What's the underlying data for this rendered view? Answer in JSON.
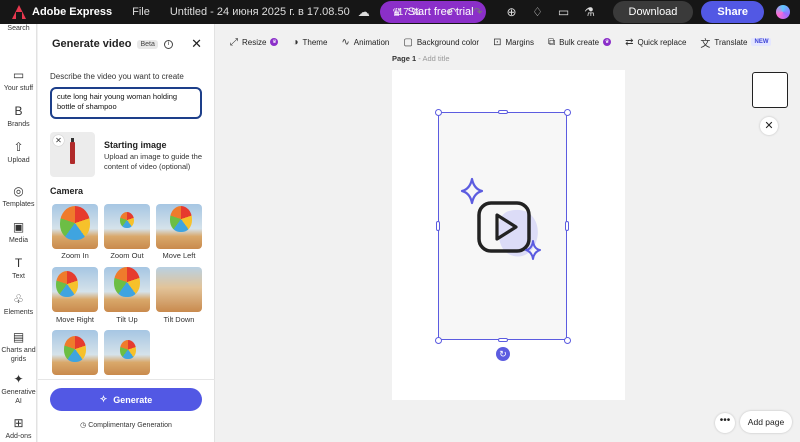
{
  "topbar": {
    "app_name": "Adobe Express",
    "file_menu": "File",
    "doc_title": "Untitled - 24 июня 2025 г. в 17.08.50",
    "trial_label": "Start free trial",
    "zoom": "17 %",
    "download_label": "Download",
    "share_label": "Share"
  },
  "rail": {
    "items": [
      {
        "label": "Search",
        "icon": "search-icon"
      },
      {
        "label": "Your stuff",
        "icon": "folder-icon"
      },
      {
        "label": "Brands",
        "icon": "brand-icon"
      },
      {
        "label": "Upload",
        "icon": "upload-icon"
      },
      {
        "label": "Templates",
        "icon": "templates-icon"
      },
      {
        "label": "Media",
        "icon": "media-icon"
      },
      {
        "label": "Text",
        "icon": "text-icon"
      },
      {
        "label": "Elements",
        "icon": "elements-icon"
      },
      {
        "label": "Charts and grids",
        "icon": "charts-icon"
      },
      {
        "label": "Generative AI",
        "icon": "generative-ai-icon"
      },
      {
        "label": "Add-ons",
        "icon": "addons-icon"
      }
    ]
  },
  "panel": {
    "title": "Generate video",
    "beta": "Beta",
    "prompt_label": "Describe the video you want to create",
    "prompt_value": "cute long hair young woman holding bottle of shampoo",
    "starting_image_title": "Starting image",
    "starting_image_desc": "Upload an image to guide the content of video (optional)",
    "camera_title": "Camera",
    "camera_options": [
      "Zoom In",
      "Zoom Out",
      "Move Left",
      "Move Right",
      "Tilt Up",
      "Tilt Down",
      "",
      ""
    ],
    "generate_label": "Generate",
    "complimentary": "Complimentary Generation"
  },
  "toolbar": {
    "items": [
      {
        "label": "Resize",
        "premium": true
      },
      {
        "label": "Theme",
        "premium": false
      },
      {
        "label": "Animation",
        "premium": false
      },
      {
        "label": "Background color",
        "premium": false
      },
      {
        "label": "Margins",
        "premium": false
      },
      {
        "label": "Bulk create",
        "premium": true
      },
      {
        "label": "Quick replace",
        "premium": false
      },
      {
        "label": "Translate",
        "premium": false,
        "badge": "NEW"
      }
    ]
  },
  "canvas": {
    "page_label": "Page 1",
    "add_title": "Add title",
    "add_page_label": "Add page"
  },
  "colors": {
    "accent": "#5258e4",
    "trial": "#8b2fc9",
    "selection": "#5c5ce0"
  }
}
